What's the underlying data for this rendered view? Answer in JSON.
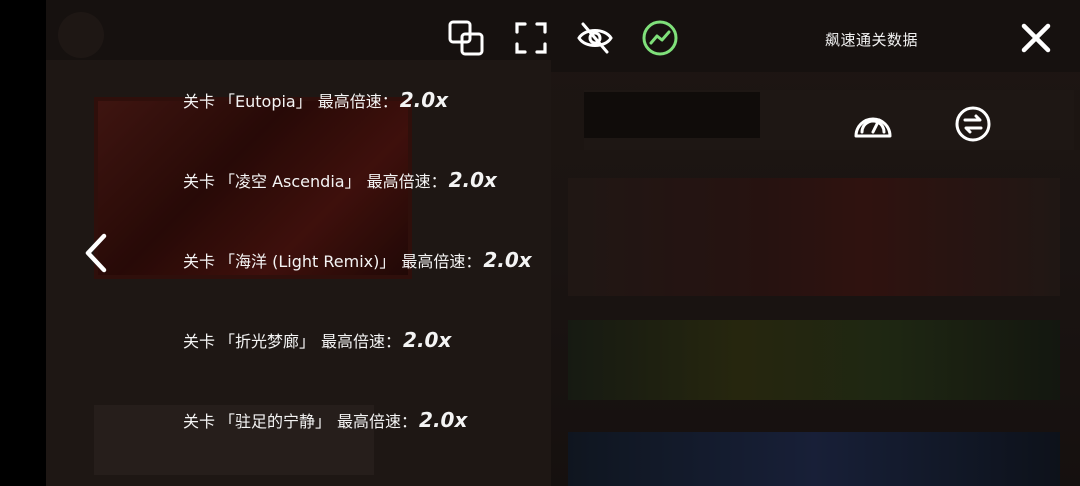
{
  "header": {
    "title": "飙速通关数据",
    "icons": [
      "copy-icon",
      "fullscreen-icon",
      "eye-off-icon",
      "trend-chart-icon",
      "close-icon"
    ],
    "active_color": "#7fe07a"
  },
  "levels": [
    {
      "prefix": "关卡",
      "name": "「Eutopia」",
      "speed_label": "最高倍速：",
      "speed": "2.0x"
    },
    {
      "prefix": "关卡",
      "name": "「凌空 Ascendia」",
      "speed_label": "最高倍速：",
      "speed": "2.0x"
    },
    {
      "prefix": "关卡",
      "name": "「海洋 (Light Remix)」",
      "speed_label": "最高倍速：",
      "speed": "2.0x"
    },
    {
      "prefix": "关卡",
      "name": "「折光梦廊」",
      "speed_label": "最高倍速：",
      "speed": "2.0x"
    },
    {
      "prefix": "关卡",
      "name": "「驻足的宁静」",
      "speed_label": "最高倍速：",
      "speed": "2.0x"
    }
  ],
  "side_icons": [
    "speedometer-icon",
    "swap-icon"
  ],
  "nav": {
    "back_icon": "chevron-left-icon"
  }
}
